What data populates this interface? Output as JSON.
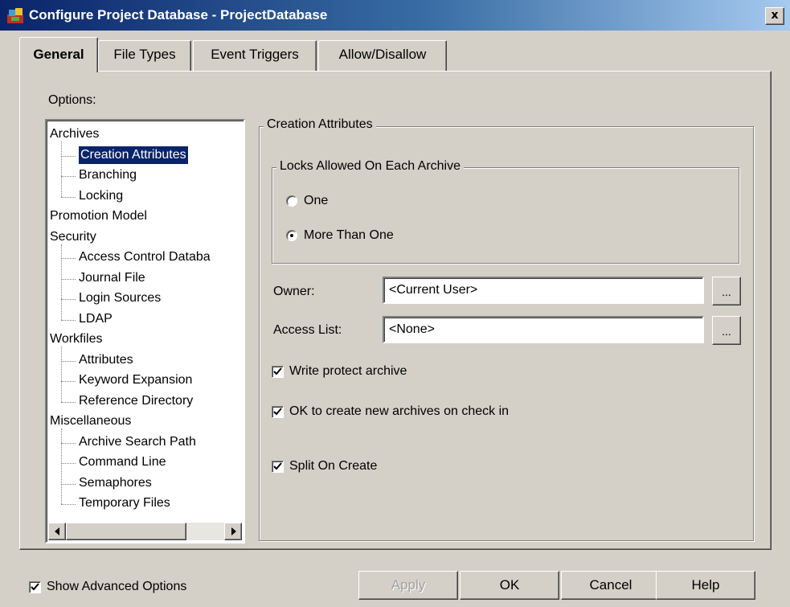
{
  "window": {
    "title": "Configure Project Database - ProjectDatabase",
    "close_label": "x"
  },
  "tabs": [
    {
      "label": "General",
      "active": true
    },
    {
      "label": "File Types",
      "active": false
    },
    {
      "label": "Event Triggers",
      "active": false
    },
    {
      "label": "Allow/Disallow",
      "active": false
    }
  ],
  "options": {
    "label": "Options:",
    "tree": [
      {
        "label": "Archives",
        "level": 0
      },
      {
        "label": "Creation Attributes",
        "level": 1,
        "selected": true
      },
      {
        "label": "Branching",
        "level": 1
      },
      {
        "label": "Locking",
        "level": 1
      },
      {
        "label": "Promotion Model",
        "level": 0
      },
      {
        "label": "Security",
        "level": 0
      },
      {
        "label": "Access Control Databa",
        "level": 1
      },
      {
        "label": "Journal File",
        "level": 1
      },
      {
        "label": "Login Sources",
        "level": 1
      },
      {
        "label": "LDAP",
        "level": 1
      },
      {
        "label": "Workfiles",
        "level": 0
      },
      {
        "label": "Attributes",
        "level": 1
      },
      {
        "label": "Keyword Expansion",
        "level": 1
      },
      {
        "label": "Reference Directory",
        "level": 1
      },
      {
        "label": "Miscellaneous",
        "level": 0
      },
      {
        "label": "Archive Search Path",
        "level": 1
      },
      {
        "label": "Command Line",
        "level": 1
      },
      {
        "label": "Semaphores",
        "level": 1
      },
      {
        "label": "Temporary Files",
        "level": 1
      }
    ]
  },
  "creation_attributes": {
    "group_title": "Creation Attributes",
    "locks": {
      "group_title": "Locks Allowed On Each Archive",
      "one_label": "One",
      "one_selected": false,
      "more_label": "More Than One",
      "more_selected": true
    },
    "owner_label": "Owner:",
    "owner_value": "<Current User>",
    "access_list_label": "Access List:",
    "access_list_value": "<None>",
    "browse_label": "...",
    "write_protect_label": "Write protect archive",
    "write_protect_checked": true,
    "ok_create_label": "OK to create new archives on check in",
    "ok_create_checked": true,
    "split_label": "Split On Create",
    "split_checked": true
  },
  "footer": {
    "show_advanced_label": "Show Advanced Options",
    "show_advanced_checked": true,
    "apply_label": "Apply",
    "ok_label": "OK",
    "cancel_label": "Cancel",
    "help_label": "Help"
  },
  "colors": {
    "face": "#d4d0c8",
    "title_active": "#0a246a",
    "selection": "#0a246a"
  }
}
